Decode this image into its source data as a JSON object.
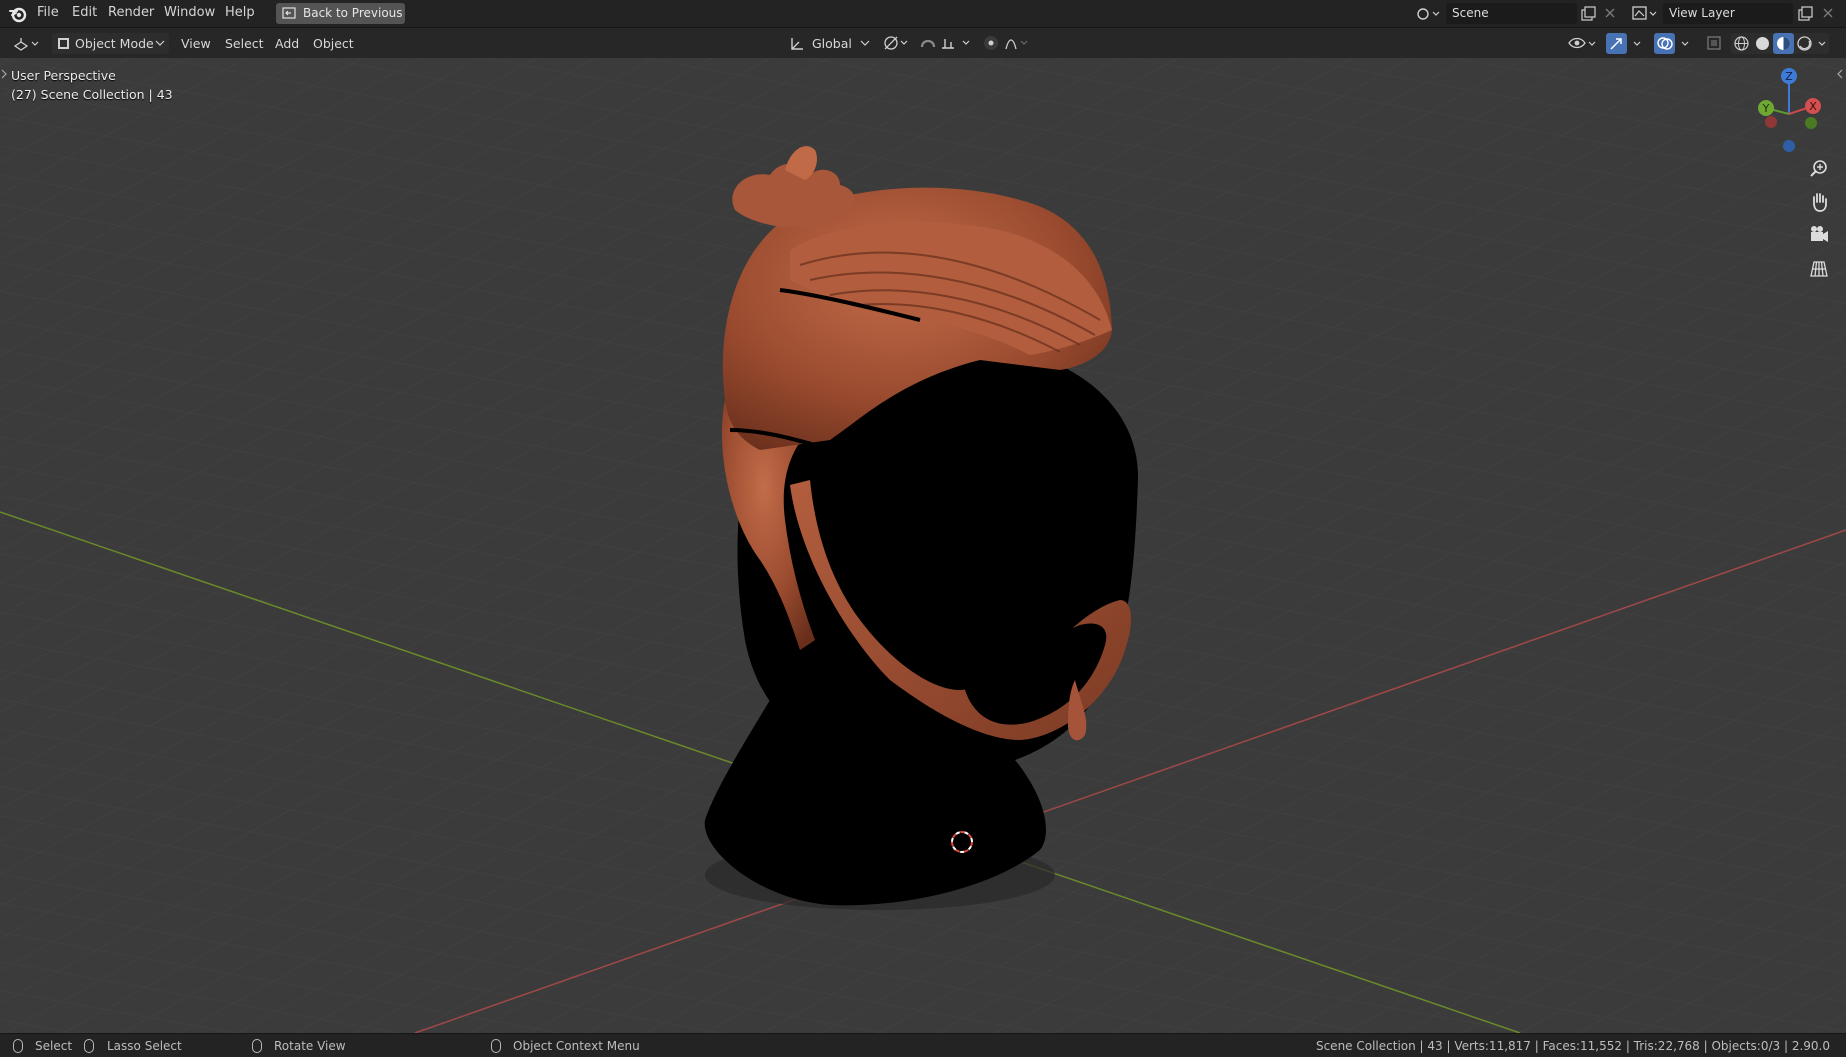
{
  "menubar": {
    "items": [
      "File",
      "Edit",
      "Render",
      "Window",
      "Help"
    ],
    "back_button": "Back to Previous",
    "scene_name": "Scene",
    "view_layer_name": "View Layer"
  },
  "header": {
    "mode": "Object Mode",
    "menus": [
      "View",
      "Select",
      "Add",
      "Object"
    ],
    "transform_orientation": "Global"
  },
  "viewport": {
    "perspective_label": "User Perspective",
    "collection_label": "(27) Scene Collection | 43",
    "gizmo_axes": [
      "Z",
      "Y",
      "X"
    ],
    "model_colors": {
      "hair": "#9a4b2f",
      "hair_highlight": "#c06a48",
      "head": "#000000",
      "grid": "#3b3b3b",
      "x_axis": "#a04848",
      "y_axis": "#6a8a2a"
    }
  },
  "statusbar": {
    "select": "Select",
    "lasso_select": "Lasso Select",
    "rotate_view": "Rotate View",
    "context_menu": "Object Context Menu",
    "stats": "Scene Collection | 43 | Verts:11,817 | Faces:11,552 | Tris:22,768 | Objects:0/3 | 2.90.0"
  }
}
